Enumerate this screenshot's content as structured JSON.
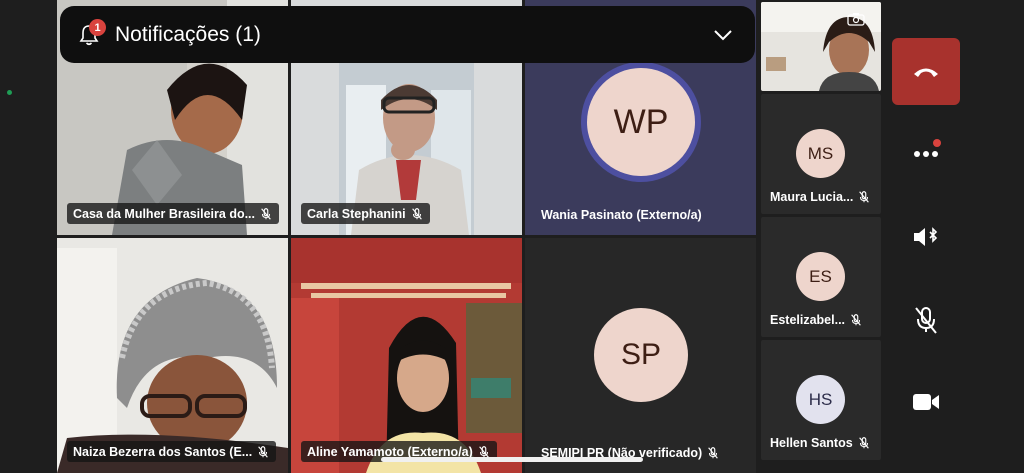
{
  "notification": {
    "title": "Notificações (1)",
    "badge_count": "1"
  },
  "participants": {
    "casa": {
      "name": "Casa da Mulher Brasileira do..."
    },
    "carla": {
      "name": "Carla Stephanini"
    },
    "wania": {
      "initials": "WP",
      "name": "Wania Pasinato (Externo/a)"
    },
    "naiza": {
      "name": "Naiza Bezerra dos Santos (E..."
    },
    "aline": {
      "name": "Aline Yamamoto (Externo/a)"
    },
    "semipi": {
      "initials": "SP",
      "name": "SEMIPI PR (Não verificado)"
    }
  },
  "sidebar": {
    "maura": {
      "initials": "MS",
      "name": "Maura Lucia..."
    },
    "estelizabel": {
      "initials": "ES",
      "name": "Estelizabel..."
    },
    "hellen": {
      "initials": "HS",
      "name": "Hellen Santos"
    }
  },
  "colors": {
    "background": "#1e1e1e",
    "hangup": "#a8322d",
    "badge": "#d9433e",
    "wania_tile": "#3b3b5c",
    "avatar_fill": "#eed5cc"
  },
  "icons": {
    "bell": "bell-icon",
    "chevron": "chevron-down-icon",
    "hangup": "phone-hangup-icon",
    "more": "more-icon",
    "speaker": "speaker-bluetooth-icon",
    "mic": "mic-off-icon",
    "camera": "video-camera-icon"
  }
}
